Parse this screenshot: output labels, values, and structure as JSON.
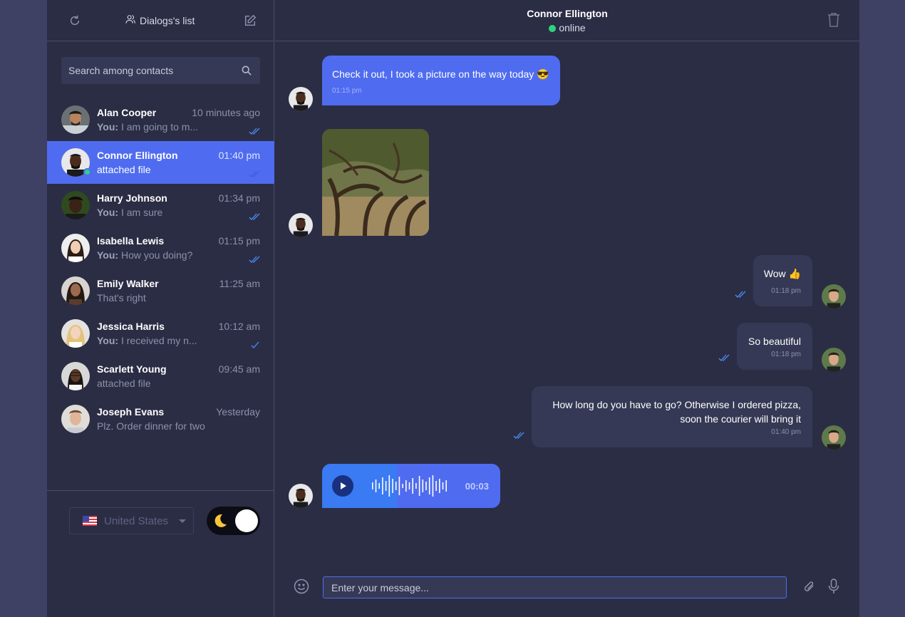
{
  "sidebar": {
    "title": "Dialogs's list",
    "search_placeholder": "Search among contacts",
    "contacts": [
      {
        "name": "Alan Cooper",
        "time": "10 minutes ago",
        "prefix": "You:",
        "message": "I am going to m...",
        "read": true
      },
      {
        "name": "Connor Ellington",
        "time": "01:40 pm",
        "prefix": "",
        "message": "attached file",
        "read": true,
        "active": true,
        "online": true
      },
      {
        "name": "Harry Johnson",
        "time": "01:34 pm",
        "prefix": "You:",
        "message": "I am sure",
        "read": true
      },
      {
        "name": "Isabella Lewis",
        "time": "01:15 pm",
        "prefix": "You:",
        "message": "How you doing?",
        "read": true
      },
      {
        "name": "Emily Walker",
        "time": "11:25 am",
        "prefix": "",
        "message": "That's right",
        "read": false
      },
      {
        "name": "Jessica Harris",
        "time": "10:12 am",
        "prefix": "You:",
        "message": "I received my n...",
        "read": true
      },
      {
        "name": "Scarlett Young",
        "time": "09:45 am",
        "prefix": "",
        "message": "attached file",
        "read": false
      },
      {
        "name": "Joseph Evans",
        "time": "Yesterday",
        "prefix": "",
        "message": "Plz. Order dinner for two",
        "read": false
      }
    ],
    "country": "United States",
    "theme": "dark"
  },
  "chat": {
    "contact_name": "Connor Ellington",
    "status": "online",
    "messages": [
      {
        "text": "Check it out, I took a picture on the way today",
        "emoji": "😎",
        "time": "01:15 pm"
      },
      {
        "text": "Wow",
        "emoji": "👍",
        "time": "01:18 pm"
      },
      {
        "text": "So beautiful",
        "time": "01:18 pm"
      },
      {
        "text_line1": "How long do you have to go? Otherwise I ordered pizza,",
        "text_line2": "soon the courier will bring it",
        "time": "01:40 pm"
      }
    ],
    "audio_duration": "00:03",
    "audio_progress": 0.42,
    "input_placeholder": "Enter your message..."
  },
  "colors": {
    "accent": "#4f6cf0",
    "background": "#2b2d45",
    "online": "#2ed47a"
  }
}
